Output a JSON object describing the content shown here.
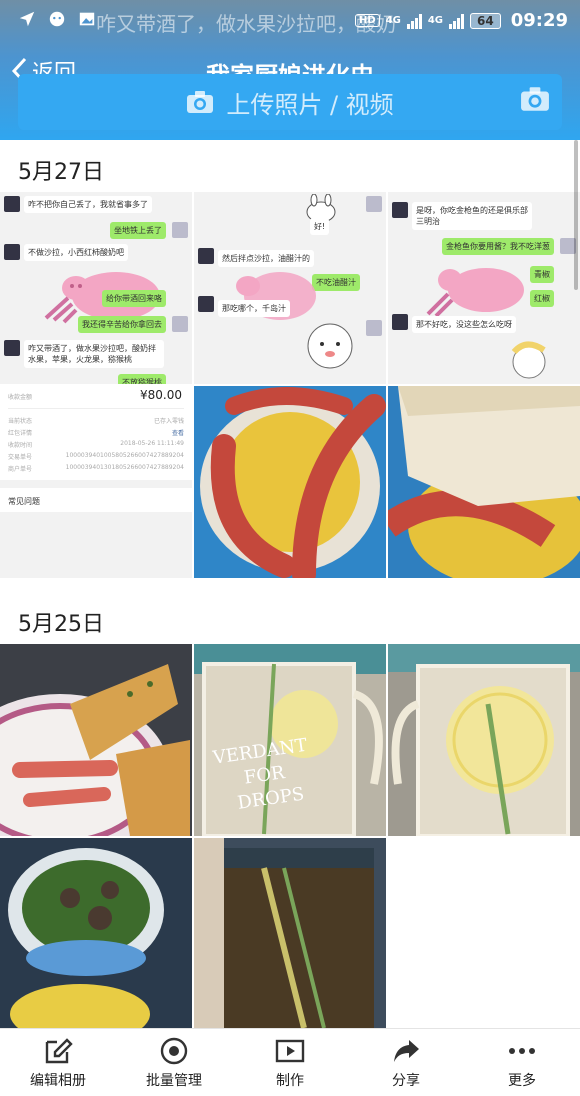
{
  "status_bar": {
    "notification_text": "咋又带酒了，做水果沙拉吧，酸奶",
    "hd": "HD",
    "net1": "4G",
    "net2": "4G",
    "battery": "64",
    "time": "09:29"
  },
  "nav": {
    "back_label": "返回",
    "title": "我家厨娘进化史"
  },
  "upload": {
    "label": "上传照片 / 视频"
  },
  "sections": [
    {
      "date": "5月27日"
    },
    {
      "date": "5月25日"
    }
  ],
  "chat1": {
    "m1": "咋不把你自己丢了，我就省事多了",
    "m2": "坐地铁上丢了",
    "m3": "不做沙拉，小西红柿酸奶吧",
    "m4": "给你带酒回来咯",
    "m5": "我还得辛苦给你拿回去",
    "m6": "咋又带酒了，做水果沙拉吧，酸奶拌水果，苹果，火龙果，猕猴桃",
    "m7": "不放猕猴桃"
  },
  "chat2": {
    "m1": "好!",
    "m2": "然后拌点沙拉，油醋汁的",
    "m3": "不吃油醋汁",
    "m4": "那吃哪个，千岛汁"
  },
  "chat3": {
    "m1": "是呀，你吃金枪鱼的还是俱乐部三明治",
    "m2": "金枪鱼你要用酱？我不吃洋葱",
    "m3": "青椒",
    "m4": "红椒",
    "m5": "那不好吃，没这些怎么吃呀"
  },
  "receipt": {
    "label_amount": "收款金额",
    "amount": "¥80.00",
    "r1_k": "当前状态",
    "r1_v": "已存入零钱",
    "r2_k": "红包详情",
    "r2_v": "查看",
    "r3_k": "收款时间",
    "r3_v": "2018-05-26 11:11:49",
    "r4_k": "交易单号",
    "r4_v": "1000039401005805266007427889204",
    "r5_k": "商户单号",
    "r5_v": "1000039401301805266007427889204",
    "faq": "常见问题"
  },
  "jar_text": {
    "line1": "VERDANT",
    "line2": "FOR",
    "line3": "DROPS"
  },
  "toolbar": {
    "items": [
      {
        "label": "编辑相册",
        "icon": "edit-icon"
      },
      {
        "label": "批量管理",
        "icon": "batch-manage-icon"
      },
      {
        "label": "制作",
        "icon": "play-icon"
      },
      {
        "label": "分享",
        "icon": "share-icon"
      },
      {
        "label": "更多",
        "icon": "more-icon"
      }
    ]
  },
  "colors": {
    "accent": "#2fa6f0",
    "chat_bubble_right": "#9eea6a"
  }
}
